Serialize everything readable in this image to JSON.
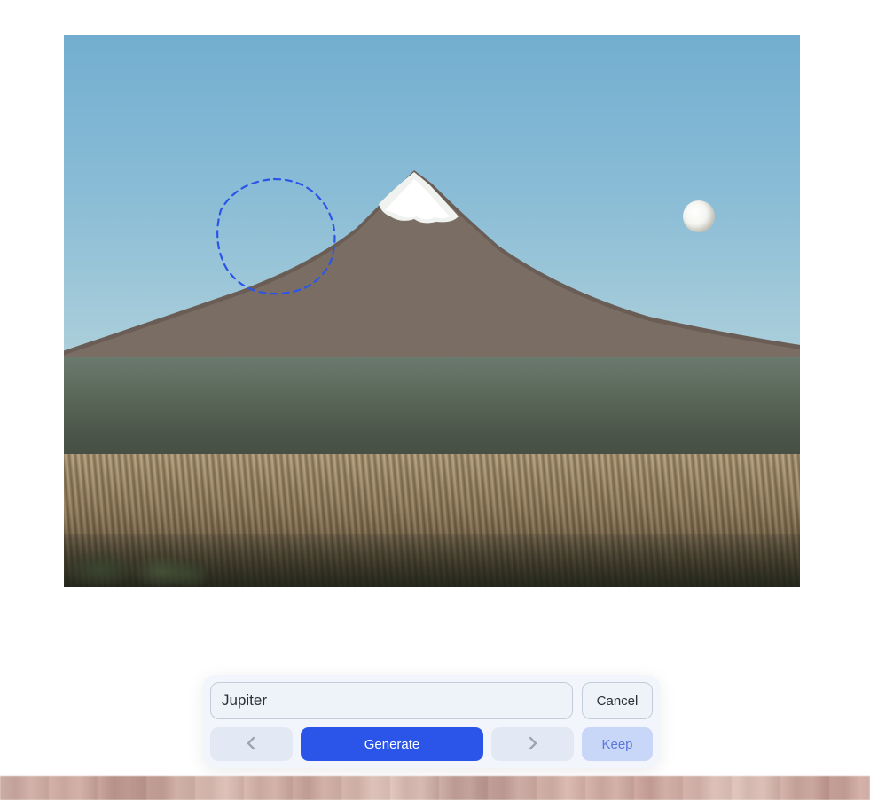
{
  "editor": {
    "selection": {
      "shape": "lasso",
      "stroke_color": "#2a55e8"
    }
  },
  "toolbar": {
    "prompt_value": "Jupiter",
    "prompt_placeholder": "",
    "cancel_label": "Cancel",
    "generate_label": "Generate",
    "keep_label": "Keep",
    "prev_icon": "chevron-left-icon",
    "next_icon": "chevron-right-icon"
  },
  "colors": {
    "accent": "#2a55e8",
    "panel_bg": "#f2f5fb",
    "input_bg": "#eef2f9",
    "border": "#c3ccda",
    "keep_bg": "#c8d6f7",
    "keep_text": "#5b79d8"
  }
}
